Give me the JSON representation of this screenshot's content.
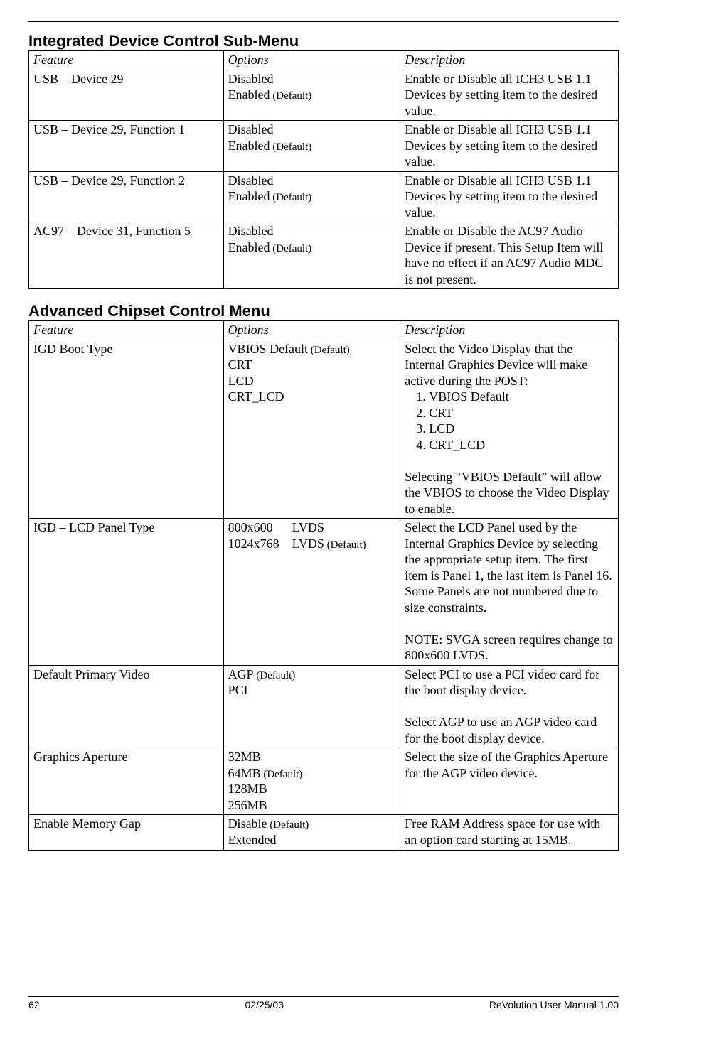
{
  "section1": {
    "title": "Integrated Device Control Sub-Menu",
    "headers": {
      "feature": "Feature",
      "options": "Options",
      "description": "Description"
    },
    "rows": [
      {
        "feature": "USB – Device 29",
        "options": [
          {
            "label": "Disabled",
            "default": false
          },
          {
            "label": "Enabled",
            "default": true
          }
        ],
        "description_paras": [
          "Enable or Disable all ICH3 USB 1.1 Devices by setting item to the desired value."
        ]
      },
      {
        "feature": "USB – Device 29, Function 1",
        "options": [
          {
            "label": "Disabled",
            "default": false
          },
          {
            "label": "Enabled",
            "default": true
          }
        ],
        "description_paras": [
          "Enable or Disable all ICH3 USB 1.1 Devices by setting item to the desired value."
        ]
      },
      {
        "feature": "USB – Device 29, Function 2",
        "options": [
          {
            "label": "Disabled",
            "default": false
          },
          {
            "label": "Enabled",
            "default": true
          }
        ],
        "description_paras": [
          "Enable or Disable all ICH3 USB 1.1 Devices by setting item to the desired value."
        ]
      },
      {
        "feature": "AC97 – Device 31, Function 5",
        "options": [
          {
            "label": "Disabled",
            "default": false
          },
          {
            "label": "Enabled",
            "default": true
          }
        ],
        "description_paras": [
          "Enable or Disable the AC97 Audio Device if present. This Setup Item will have no effect if an AC97 Audio MDC is not present."
        ]
      }
    ]
  },
  "section2": {
    "title": "Advanced Chipset Control Menu",
    "headers": {
      "feature": "Feature",
      "options": "Options",
      "description": "Description"
    },
    "rows": [
      {
        "feature": "IGD Boot Type",
        "options": [
          {
            "label": "VBIOS Default",
            "default": true
          },
          {
            "label": "CRT",
            "default": false
          },
          {
            "label": "LCD",
            "default": false
          },
          {
            "label": "CRT_LCD",
            "default": false
          }
        ],
        "description_paras": [
          "Select the Video Display that the Internal Graphics Device will make active during the POST:"
        ],
        "description_list": [
          "VBIOS Default",
          "CRT",
          "LCD",
          "CRT_LCD"
        ],
        "description_paras_after": [
          "Selecting “VBIOS Default” will allow the VBIOS to choose the Video Display to enable."
        ]
      },
      {
        "feature": "IGD – LCD Panel Type",
        "options": [
          {
            "label": "800x600      LVDS",
            "default": false
          },
          {
            "label": "1024x768    LVDS",
            "default": true
          }
        ],
        "description_paras": [
          "Select the LCD Panel used by the Internal Graphics Device by selecting the appropriate setup item. The first item is Panel 1, the last item is Panel 16. Some Panels are not numbered due to size constraints."
        ],
        "description_paras_after": [
          "NOTE: SVGA screen requires change to 800x600 LVDS."
        ]
      },
      {
        "feature": "Default Primary Video",
        "options": [
          {
            "label": "AGP",
            "default": true
          },
          {
            "label": "PCI",
            "default": false
          }
        ],
        "description_paras": [
          "Select PCI to use a PCI video card for the boot display device."
        ],
        "description_paras_after": [
          "Select AGP to use an AGP video card for the boot display device."
        ]
      },
      {
        "feature": "Graphics Aperture",
        "options": [
          {
            "label": "32MB",
            "default": false
          },
          {
            "label": "64MB",
            "default": true
          },
          {
            "label": "128MB",
            "default": false
          },
          {
            "label": "256MB",
            "default": false
          }
        ],
        "description_paras": [
          "Select the size of the Graphics Aperture for the AGP video device."
        ]
      },
      {
        "feature": "Enable Memory Gap",
        "options": [
          {
            "label": "Disable",
            "default": true
          },
          {
            "label": "Extended",
            "default": false
          }
        ],
        "description_paras": [
          "Free RAM Address space for use with an option card starting at 15MB."
        ]
      }
    ]
  },
  "default_suffix": " (Default)",
  "footer": {
    "page": "62",
    "date": "02/25/03",
    "manual": "ReVolution User Manual 1.00"
  }
}
